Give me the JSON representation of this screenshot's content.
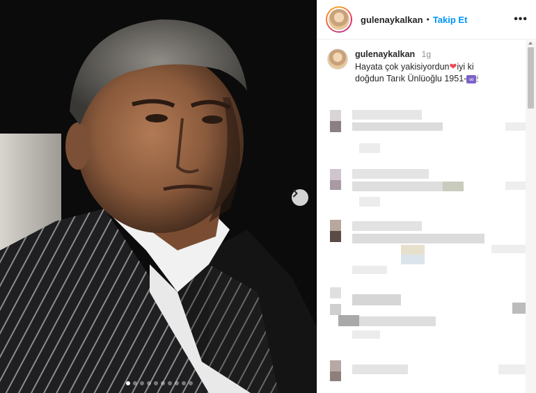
{
  "post": {
    "username": "gulenaykalkan",
    "separator": "•",
    "follow_label": "Takip Et",
    "more_label": "•••",
    "next_label": "›",
    "slide_count": 10,
    "active_slide": 1
  },
  "caption": {
    "username": "gulenaykalkan",
    "time": "1g",
    "text_line1": "Hayata çok yakisiyordun",
    "heart": "❤",
    "text_line1b": "iyi ki",
    "text_line2": "doğdun Tarık Ünlüoğlu 1951-",
    "infinity": "∞",
    "candle": "🕯"
  },
  "colors": {
    "follow": "#0095f6",
    "heart": "#ed4956",
    "photo_bg": "#0b0b0b"
  }
}
